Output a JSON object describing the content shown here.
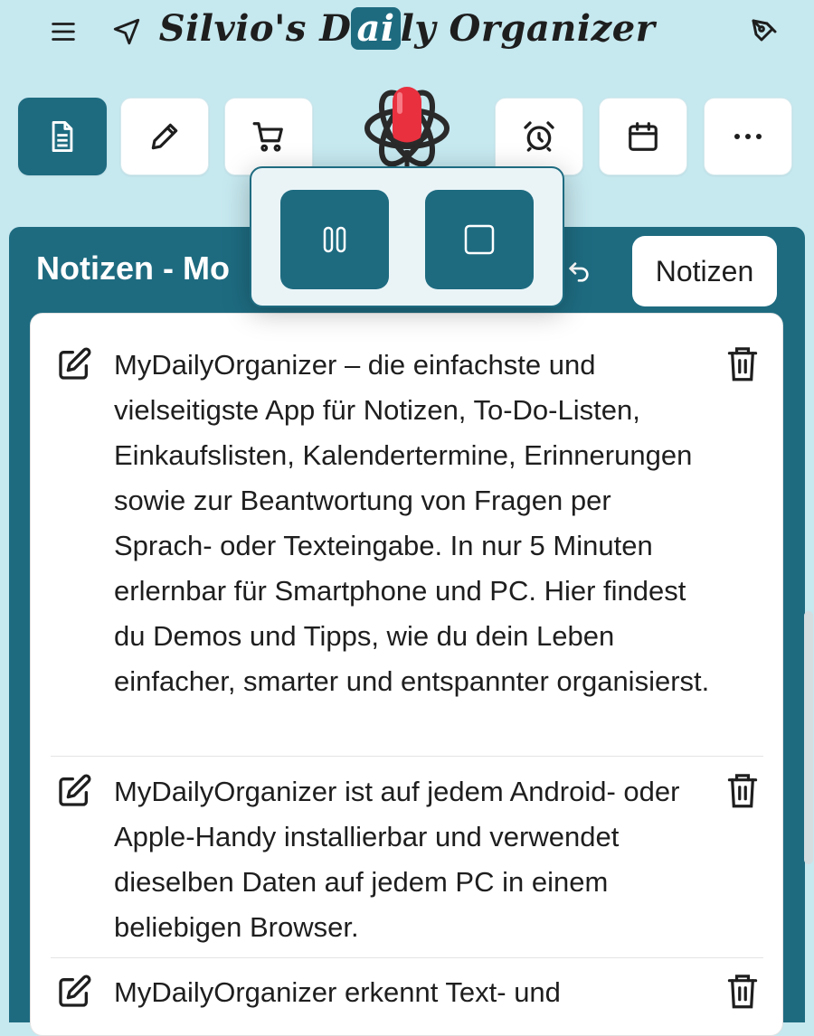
{
  "app": {
    "title_before": "Silvio's D",
    "title_highlight": "ai",
    "title_after": "ly Organizer"
  },
  "icons": {
    "menu": "hamburger-menu-icon",
    "send": "navigation-arrow-icon",
    "pen": "pen-tool-icon",
    "notes": "document-icon",
    "todo": "pencil-icon",
    "shopping": "shopping-cart-icon",
    "mic": "microphone-icon",
    "alarm": "alarm-clock-icon",
    "calendar": "calendar-icon",
    "more": "more-horizontal-icon",
    "undo": "undo-icon",
    "edit": "edit-icon",
    "delete": "trash-icon",
    "pause": "pause-icon",
    "stop": "stop-icon"
  },
  "colors": {
    "accent": "#1e6b80",
    "background": "#c6e8ef",
    "mic_red": "#e8303f"
  },
  "panel": {
    "title": "Notizen - Mo",
    "notes_button": "Notizen"
  },
  "notes": [
    {
      "text": "MyDailyOrganizer – die einfachste und vielseitigste App für Notizen, To-Do-Listen, Einkaufslisten, Kalendertermine, Erinnerungen sowie zur Beantwortung von Fragen per Sprach- oder Texteingabe. In nur 5 Minuten erlernbar für Smartphone und PC. Hier findest du Demos und Tipps, wie du dein Leben einfacher, smarter und entspannter organisierst."
    },
    {
      "text": "MyDailyOrganizer ist auf jedem Android- oder Apple-Handy installierbar und verwendet dieselben Daten auf jedem PC in einem beliebigen Browser."
    },
    {
      "text": "MyDailyOrganizer erkennt Text- und"
    }
  ]
}
